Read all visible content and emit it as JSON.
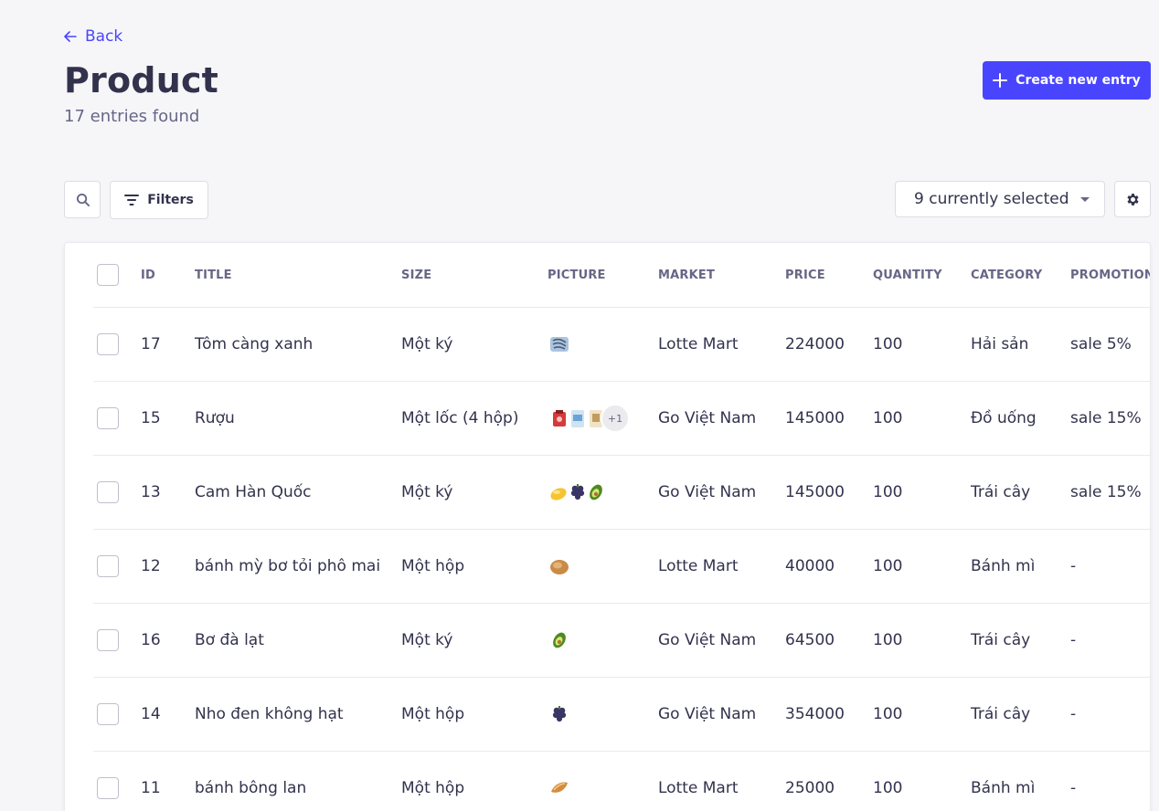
{
  "header": {
    "back_label": "Back",
    "title": "Product",
    "entries_found": "17 entries found",
    "create_label": "Create new entry"
  },
  "toolbar": {
    "filters_label": "Filters",
    "columns_selected": "9 currently selected"
  },
  "colors": {
    "primary": "#4945ff",
    "background": "#f6f6f9",
    "text": "#32324d",
    "muted": "#666687"
  },
  "table": {
    "columns": [
      "ID",
      "TITLE",
      "SIZE",
      "PICTURE",
      "MARKET",
      "PRICE",
      "QUANTITY",
      "CATEGORY",
      "PROMOTION"
    ],
    "rows": [
      {
        "id": "17",
        "title": "Tôm càng xanh",
        "size": "Một ký",
        "pictures": [
          "shrimp-icon"
        ],
        "extra": "",
        "market": "Lotte Mart",
        "price": "224000",
        "quantity": "100",
        "category": "Hải sản",
        "promotion": "sale 5%"
      },
      {
        "id": "15",
        "title": "Rượu",
        "size": "Một lốc (4 hộp)",
        "pictures": [
          "wine-box-red-icon",
          "wine-box-blue-icon",
          "wine-box-cream-icon"
        ],
        "extra": "+1",
        "market": "Go Việt Nam",
        "price": "145000",
        "quantity": "100",
        "category": "Đồ uống",
        "promotion": "sale 15%"
      },
      {
        "id": "13",
        "title": "Cam Hàn Quốc",
        "size": "Một ký",
        "pictures": [
          "orange-icon",
          "grape-icon",
          "avocado-icon"
        ],
        "extra": "",
        "market": "Go Việt Nam",
        "price": "145000",
        "quantity": "100",
        "category": "Trái cây",
        "promotion": "sale 15%"
      },
      {
        "id": "12",
        "title": "bánh mỳ bơ tỏi phô mai",
        "size": "Một hộp",
        "pictures": [
          "bread-icon"
        ],
        "extra": "",
        "market": "Lotte Mart",
        "price": "40000",
        "quantity": "100",
        "category": "Bánh mì",
        "promotion": "-"
      },
      {
        "id": "16",
        "title": "Bơ đà lạt",
        "size": "Một ký",
        "pictures": [
          "avocado-icon"
        ],
        "extra": "",
        "market": "Go Việt Nam",
        "price": "64500",
        "quantity": "100",
        "category": "Trái cây",
        "promotion": "-"
      },
      {
        "id": "14",
        "title": "Nho đen không hạt",
        "size": "Một hộp",
        "pictures": [
          "grape-icon"
        ],
        "extra": "",
        "market": "Go Việt Nam",
        "price": "354000",
        "quantity": "100",
        "category": "Trái cây",
        "promotion": "-"
      },
      {
        "id": "11",
        "title": "bánh bông lan",
        "size": "Một hộp",
        "pictures": [
          "sponge-cake-icon"
        ],
        "extra": "",
        "market": "Lotte Mart",
        "price": "25000",
        "quantity": "100",
        "category": "Bánh mì",
        "promotion": "-"
      }
    ]
  }
}
